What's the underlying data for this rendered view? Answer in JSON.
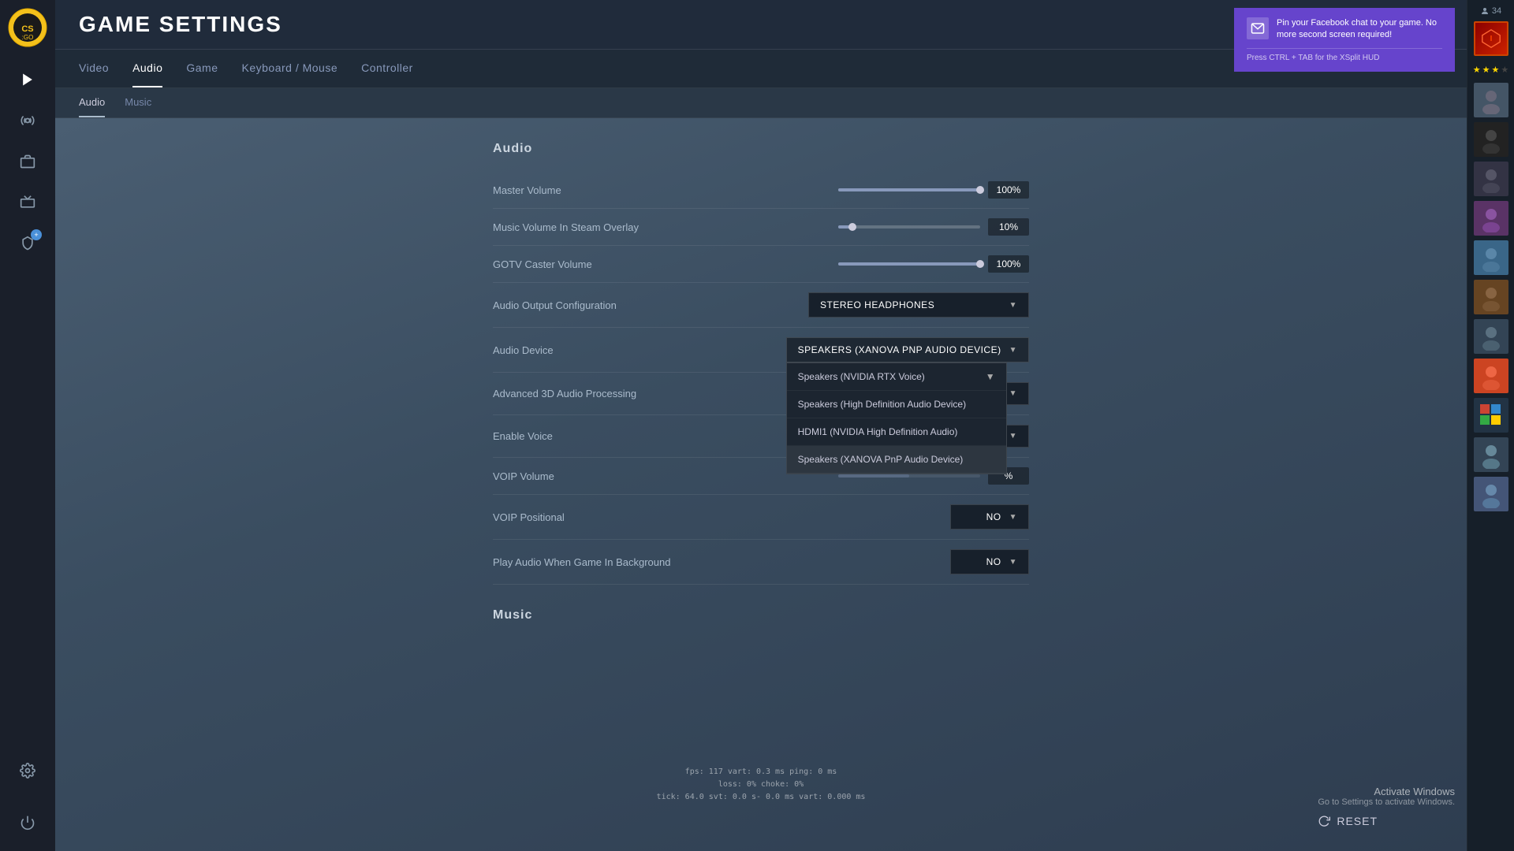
{
  "app": {
    "title": "GAME SETTINGS",
    "logo_text": "CS:GO"
  },
  "sidebar": {
    "icons": [
      {
        "name": "play-icon",
        "symbol": "▶",
        "active": true
      },
      {
        "name": "broadcast-icon",
        "symbol": "📡",
        "active": false
      },
      {
        "name": "inventory-icon",
        "symbol": "🎒",
        "active": false
      },
      {
        "name": "tv-icon",
        "symbol": "📺",
        "active": false
      },
      {
        "name": "shield-icon",
        "symbol": "🛡",
        "active": false,
        "badge": "+"
      },
      {
        "name": "settings-icon",
        "symbol": "⚙",
        "active": false
      }
    ]
  },
  "nav_tabs": [
    {
      "label": "Video",
      "active": false
    },
    {
      "label": "Audio",
      "active": true
    },
    {
      "label": "Game",
      "active": false
    },
    {
      "label": "Keyboard / Mouse",
      "active": false
    },
    {
      "label": "Controller",
      "active": false
    }
  ],
  "sub_tabs": [
    {
      "label": "Audio",
      "active": true
    },
    {
      "label": "Music",
      "active": false
    }
  ],
  "sections": {
    "audio": {
      "title": "Audio",
      "settings": [
        {
          "label": "Master Volume",
          "type": "slider",
          "value": "100%",
          "fill_pct": 100
        },
        {
          "label": "Music Volume In Steam Overlay",
          "type": "slider",
          "value": "10%",
          "fill_pct": 10
        },
        {
          "label": "GOTV Caster Volume",
          "type": "slider",
          "value": "100%",
          "fill_pct": 100
        },
        {
          "label": "Audio Output Configuration",
          "type": "dropdown",
          "value": "STEREO HEADPHONES",
          "open": false
        },
        {
          "label": "Audio Device",
          "type": "dropdown",
          "value": "SPEAKERS (XANOVA PNP AUDIO DEVICE)",
          "open": true,
          "options": [
            {
              "label": "Speakers (NVIDIA RTX Voice)",
              "has_arrow": true
            },
            {
              "label": "Speakers (High Definition Audio Device)",
              "has_arrow": false
            },
            {
              "label": "HDMI1 (NVIDIA High Definition Audio)",
              "has_arrow": false
            },
            {
              "label": "Speakers (XANOVA PnP Audio Device)",
              "has_arrow": false,
              "selected": true
            }
          ]
        },
        {
          "label": "Advanced 3D Audio Processing",
          "type": "dropdown_simple",
          "value": ""
        },
        {
          "label": "Enable Voice",
          "type": "dropdown_simple",
          "value": ""
        },
        {
          "label": "VOIP Volume",
          "type": "slider_pct",
          "value": "%"
        },
        {
          "label": "VOIP Positional",
          "type": "dropdown_no",
          "value": "NO"
        },
        {
          "label": "Play Audio When Game In Background",
          "type": "dropdown_no",
          "value": "NO"
        }
      ]
    },
    "music": {
      "title": "Music"
    }
  },
  "notification": {
    "title": "Pin your Facebook chat to your game. No more second screen required!",
    "sub": "Press CTRL + TAB for the XSplit HUD"
  },
  "footer_stats": {
    "line1": "fps:  117  vart: 0.3 ms  ping: 0 ms",
    "line2": "loss: 0%  choke: 0%",
    "line3": "tick: 64.0  svt: 0.0 s- 0.0 ms  vart: 0.000 ms"
  },
  "activate_windows": {
    "title": "Activate Windows",
    "sub": "Go to Settings to activate Windows."
  },
  "reset_button": {
    "label": "RESET"
  },
  "right_sidebar": {
    "friend_count": "34",
    "avatars": [
      {
        "color": "#8B1500",
        "has_rank": true
      },
      {
        "color": "#556677"
      },
      {
        "color": "#223344"
      },
      {
        "color": "#445566"
      },
      {
        "color": "#667788"
      },
      {
        "color": "#5a3366"
      },
      {
        "color": "#336688"
      },
      {
        "color": "#8B6633"
      },
      {
        "color": "#334455"
      },
      {
        "color": "#cc4422"
      },
      {
        "color": "#223344"
      },
      {
        "color": "#667788"
      },
      {
        "color": "#334455"
      },
      {
        "color": "#445577"
      }
    ],
    "stars": [
      true,
      true,
      true,
      false
    ]
  }
}
